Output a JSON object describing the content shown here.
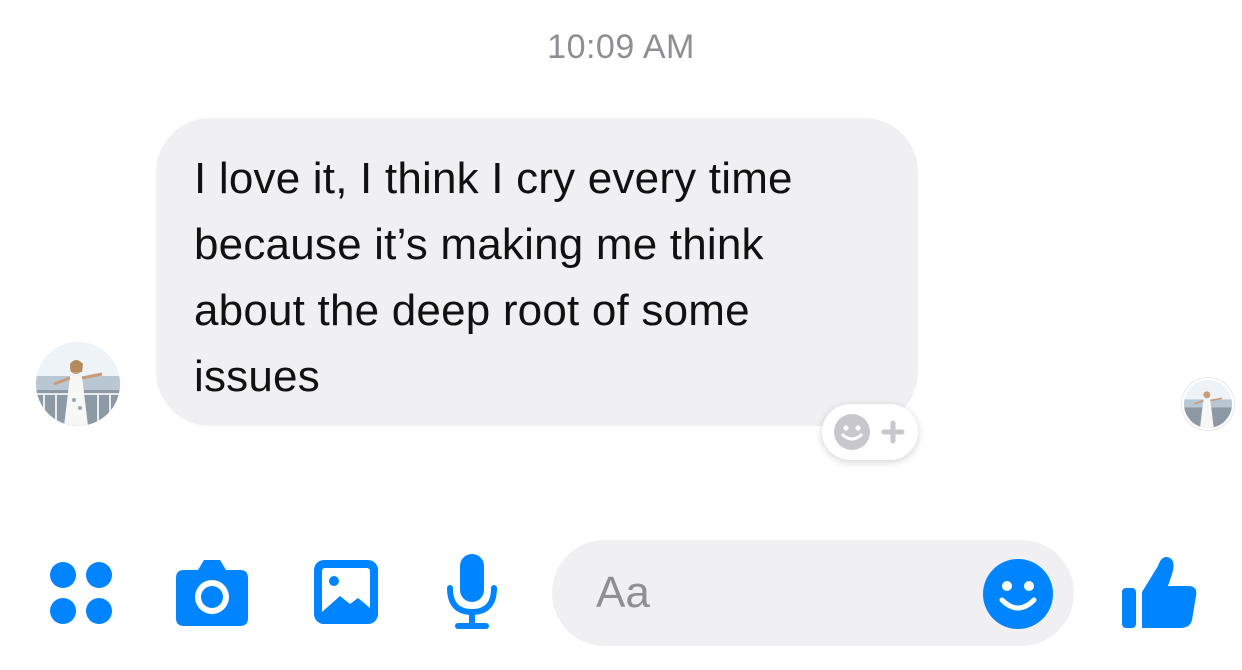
{
  "thread": {
    "timestamp": "10:09 AM",
    "message": {
      "text": "I love it, I think I cry every time\nbecause it’s making me think\nabout the deep root of some\nissues"
    }
  },
  "compose": {
    "placeholder": "Aa"
  },
  "icons": {
    "menu": "four-dots-menu-icon",
    "camera": "camera-icon",
    "gallery": "photo-gallery-icon",
    "mic": "microphone-icon",
    "emoji": "emoji-smiley-icon",
    "like": "thumbs-up-icon",
    "reaction": "add-reaction-icon"
  },
  "colors": {
    "accent": "#0084ff",
    "bubble": "#f0f0f2",
    "timestamp": "#8e8e93"
  }
}
